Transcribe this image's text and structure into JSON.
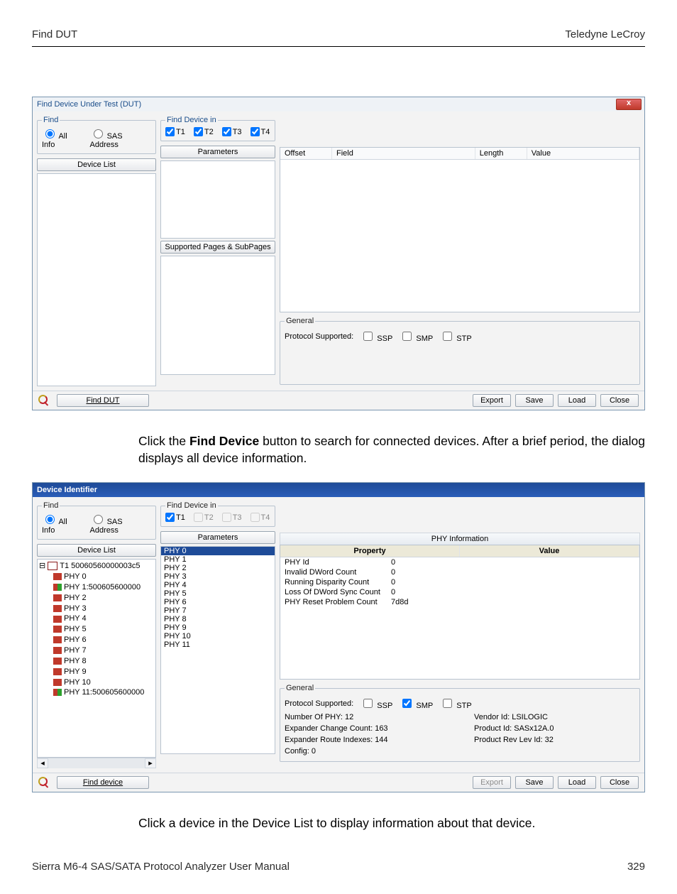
{
  "hdr": {
    "left": "Find DUT",
    "right": "Teledyne LeCroy"
  },
  "ftr": {
    "left": "Sierra M6-4 SAS/SATA Protocol Analyzer User Manual",
    "right": "329"
  },
  "para1_pre": "Click the ",
  "para1_bold": "Find Device",
  "para1_post": " button to search for connected devices. After a brief period, the dialog displays all device information.",
  "para2": "Click a device in the Device List to display information about that device.",
  "dlg1": {
    "title": "Find Device Under Test (DUT)",
    "find_legend": "Find",
    "allinfo": "All Info",
    "sas": "SAS Address",
    "findin_legend": "Find Device in",
    "t": [
      "T1",
      "T2",
      "T3",
      "T4"
    ],
    "t_checked": [
      true,
      true,
      true,
      true
    ],
    "t_enabled": [
      true,
      true,
      true,
      true
    ],
    "device_list_btn": "Device List",
    "params_btn": "Parameters",
    "subpages_btn": "Supported Pages & SubPages",
    "tbl": {
      "offset": "Offset",
      "field": "Field",
      "length": "Length",
      "value": "Value"
    },
    "general_legend": "General",
    "proto_label": "Protocol Supported:",
    "proto": [
      "SSP",
      "SMP",
      "STP"
    ],
    "find_btn": "Find DUT",
    "actions": {
      "export": "Export",
      "save": "Save",
      "load": "Load",
      "close": "Close"
    }
  },
  "dlg2": {
    "title": "Device Identifier",
    "find_legend": "Find",
    "allinfo": "All Info",
    "sas": "SAS Address",
    "findin_legend": "Find Device in",
    "t": [
      "T1",
      "T2",
      "T3",
      "T4"
    ],
    "t_checked": [
      true,
      false,
      false,
      false
    ],
    "t_enabled": [
      true,
      false,
      false,
      false
    ],
    "device_list_btn": "Device List",
    "params_btn": "Parameters",
    "tree": {
      "root": "T1  50060560000003c5",
      "items": [
        {
          "label": "PHY 0",
          "type": "red"
        },
        {
          "label": "PHY 1:500605600000",
          "type": "mix"
        },
        {
          "label": "PHY 2",
          "type": "red"
        },
        {
          "label": "PHY 3",
          "type": "red"
        },
        {
          "label": "PHY 4",
          "type": "red"
        },
        {
          "label": "PHY 5",
          "type": "red"
        },
        {
          "label": "PHY 6",
          "type": "red"
        },
        {
          "label": "PHY 7",
          "type": "red"
        },
        {
          "label": "PHY 8",
          "type": "red"
        },
        {
          "label": "PHY 9",
          "type": "red"
        },
        {
          "label": "PHY 10",
          "type": "red"
        },
        {
          "label": "PHY 11:500605600000",
          "type": "mix"
        }
      ]
    },
    "params_list": [
      "PHY 0",
      "PHY 1",
      "PHY 2",
      "PHY 3",
      "PHY 4",
      "PHY 5",
      "PHY 6",
      "PHY 7",
      "PHY 8",
      "PHY 9",
      "PHY 10",
      "PHY 11"
    ],
    "phy_info_header": "PHY Information",
    "prop_h": "Property",
    "val_h": "Value",
    "props": [
      {
        "k": "PHY Id",
        "v": "0"
      },
      {
        "k": "Invalid DWord Count",
        "v": "0"
      },
      {
        "k": "Running Disparity Count",
        "v": "0"
      },
      {
        "k": "Loss Of DWord Sync Count",
        "v": "0"
      },
      {
        "k": "PHY Reset Problem Count",
        "v": "7d8d"
      }
    ],
    "general_legend": "General",
    "proto_label": "Protocol Supported:",
    "proto": [
      "SSP",
      "SMP",
      "STP"
    ],
    "proto_checked": [
      false,
      true,
      false
    ],
    "gen_left": [
      {
        "k": "Number Of PHY:",
        "v": "12"
      },
      {
        "k": "Expander Change Count:",
        "v": "163"
      },
      {
        "k": "Expander Route Indexes:",
        "v": "144"
      },
      {
        "k": "Config:",
        "v": "0"
      }
    ],
    "gen_right": [
      {
        "k": "Vendor Id:",
        "v": "LSILOGIC"
      },
      {
        "k": "Product Id:",
        "v": "SASx12A.0"
      },
      {
        "k": "Product Rev Lev Id:",
        "v": "32"
      }
    ],
    "find_btn": "Find device",
    "actions": {
      "export": "Export",
      "save": "Save",
      "load": "Load",
      "close": "Close"
    }
  }
}
